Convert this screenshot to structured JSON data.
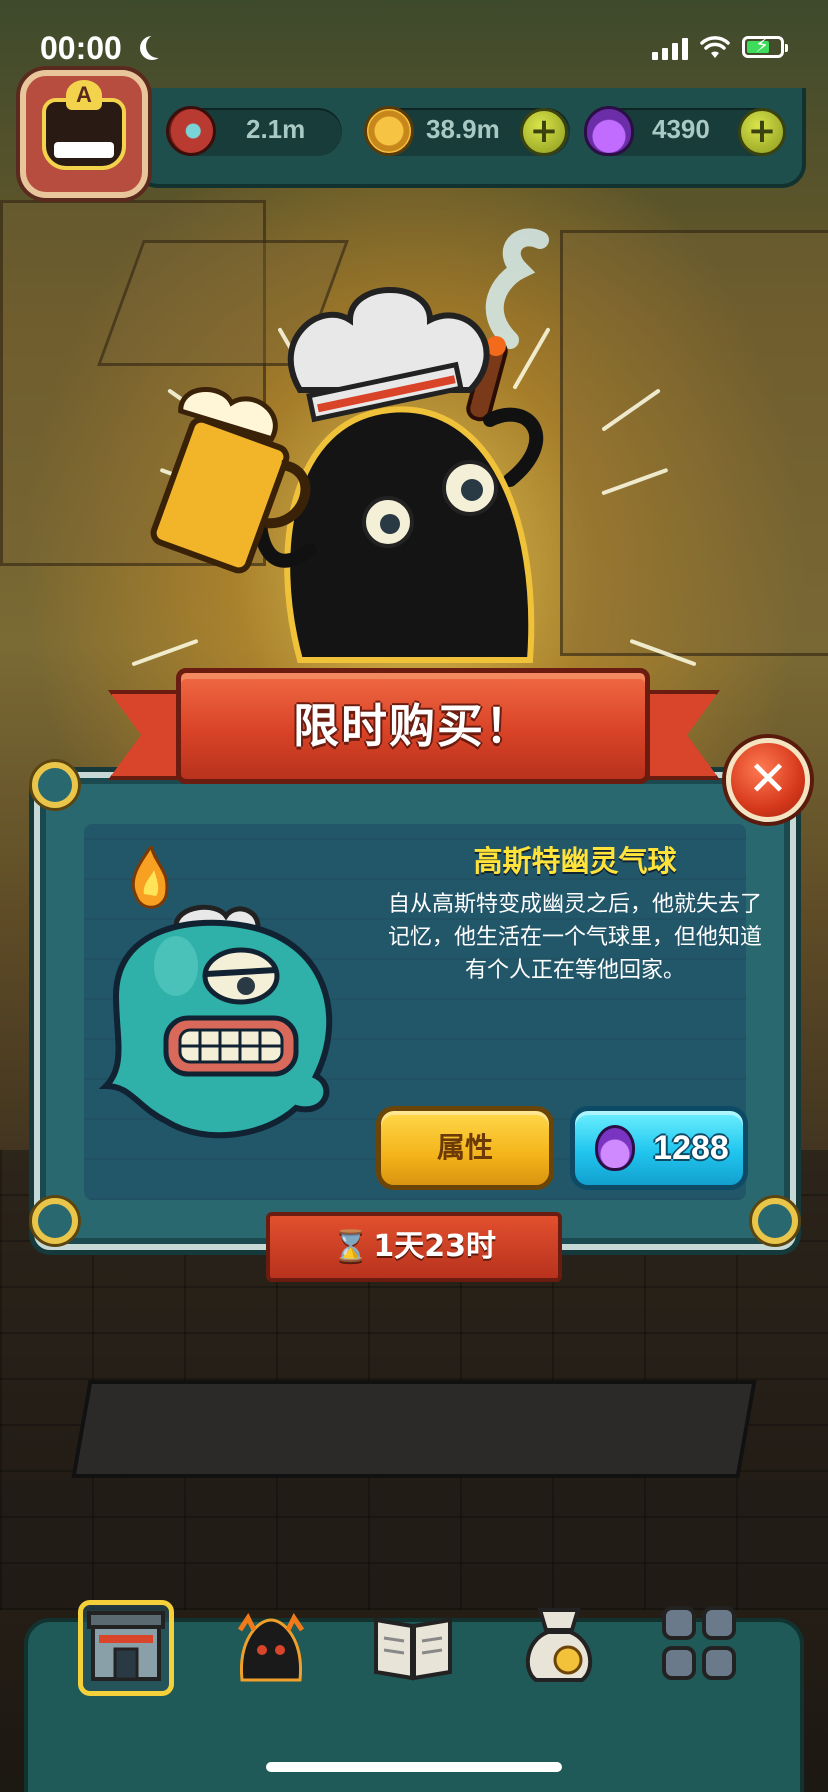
{
  "status_bar": {
    "time": "00:00",
    "moon_icon": "moon-icon",
    "signal_icon": "cellular-signal-icon",
    "wifi_icon": "wifi-icon",
    "battery_icon": "battery-charging-icon",
    "battery_level": 0.7
  },
  "resources": {
    "eyes": {
      "icon": "eyeball-icon",
      "value": "2.1m"
    },
    "coins": {
      "icon": "coin-icon",
      "value": "38.9m"
    },
    "potions": {
      "icon": "potion-icon",
      "value": "4390"
    }
  },
  "avatar": {
    "badge_letter": "A"
  },
  "offer": {
    "banner_title": "限时购买！",
    "item_name": "高斯特幽灵气球",
    "item_description": "自从高斯特变成幽灵之后，他就失去了记忆，他生活在一个气球里，但他知道有个人正在等他回家。",
    "attributes_button": "属性",
    "price": "1288",
    "price_icon": "potion-icon",
    "timer": "1天23时"
  },
  "bottom_nav": {
    "items": [
      {
        "icon": "shop-building-icon",
        "active": true
      },
      {
        "icon": "monster-icon",
        "active": false
      },
      {
        "icon": "book-icon",
        "active": false
      },
      {
        "icon": "money-bag-icon",
        "active": false
      },
      {
        "icon": "monster-grid-icon",
        "active": false
      }
    ]
  },
  "colors": {
    "ribbon_red": "#d94327",
    "panel_teal": "#2a6870",
    "title_yellow": "#ffe23a",
    "attr_button_yellow": "#f4b41a",
    "buy_button_cyan": "#21c6ee",
    "hud_teal": "#1f4f4c"
  }
}
